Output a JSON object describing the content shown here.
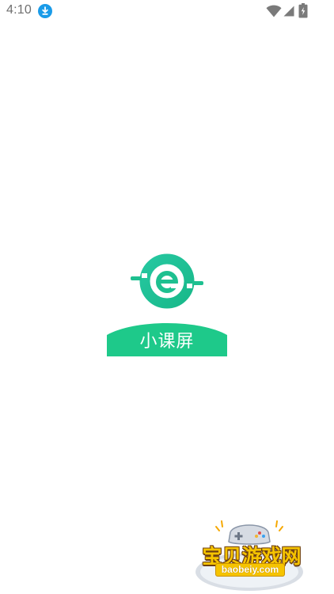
{
  "status_bar": {
    "time": "4:10",
    "icons": [
      "download-icon",
      "wifi-icon",
      "signal-icon",
      "battery-icon"
    ]
  },
  "splash": {
    "app_name": "小课屏",
    "brand_color": "#1ec98a",
    "logo_icon": "app-logo-icon"
  },
  "watermark": {
    "title": "宝贝游戏网",
    "url": "baobeiy.com",
    "icon": "gamepad-icon"
  }
}
